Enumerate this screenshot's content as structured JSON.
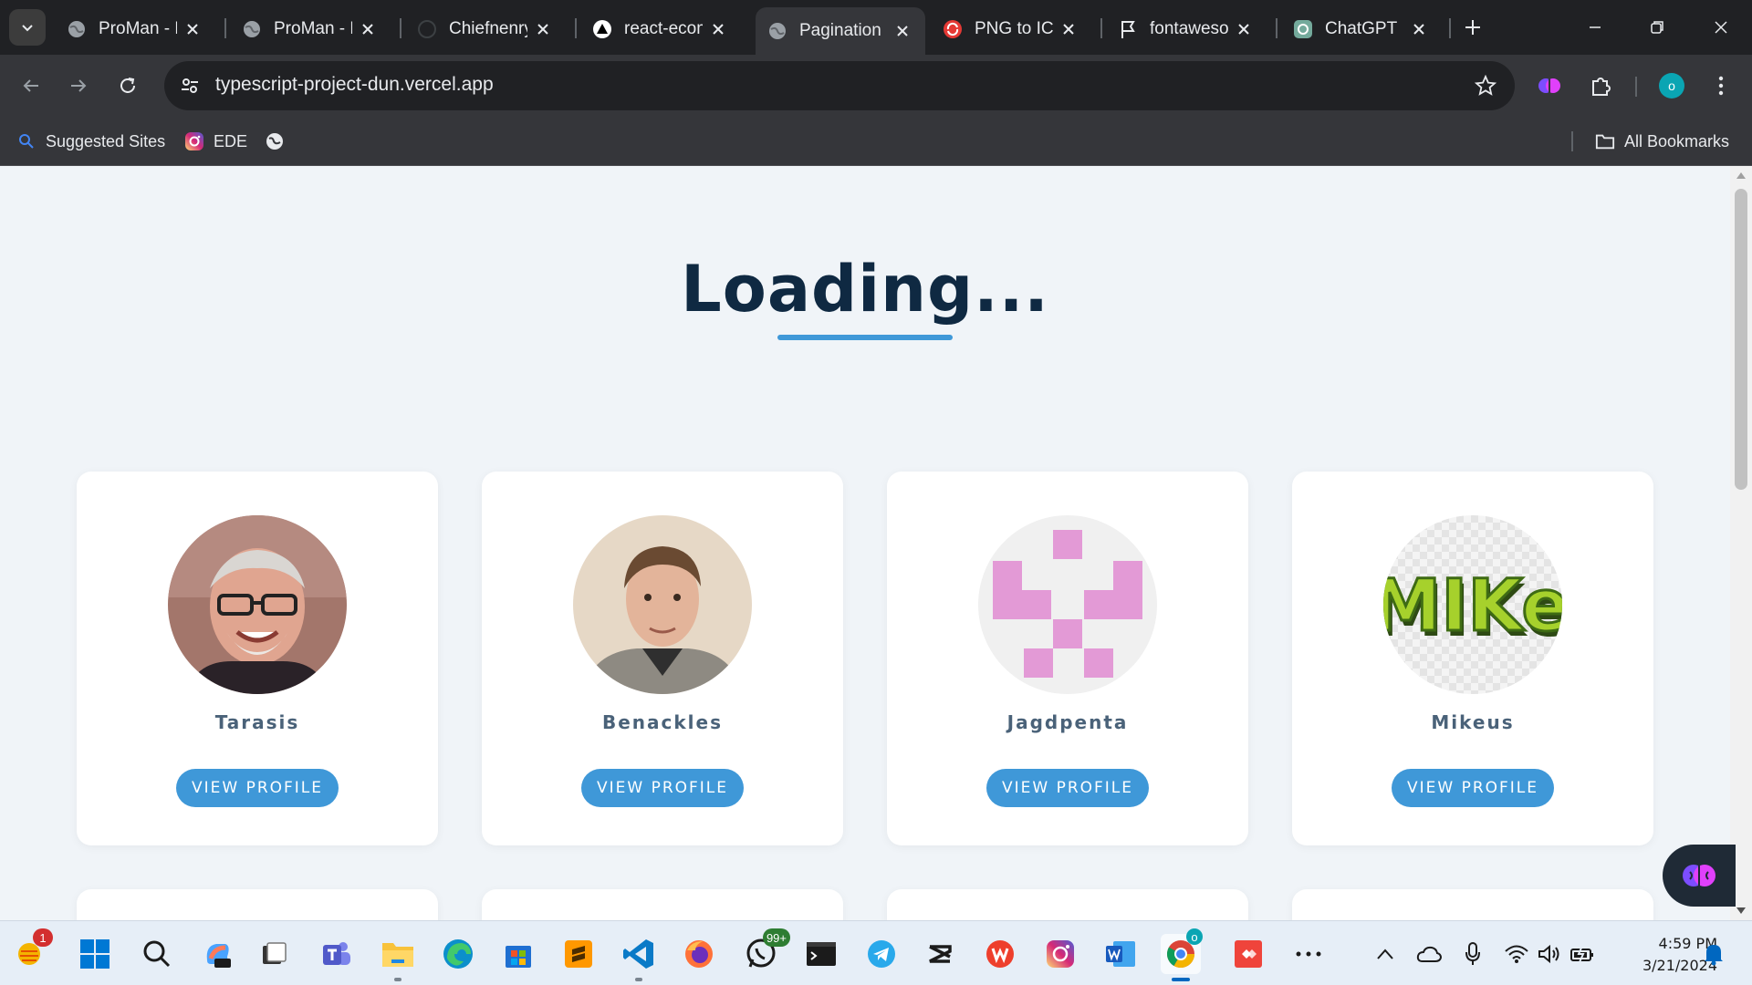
{
  "browser": {
    "tabs": [
      {
        "title": "ProMan - F",
        "icon": "globe-icon"
      },
      {
        "title": "ProMan - F",
        "icon": "globe-icon"
      },
      {
        "title": "Chiefnenry",
        "icon": "github-icon"
      },
      {
        "title": "react-ecom",
        "icon": "vercel-icon"
      },
      {
        "title": "Pagination",
        "icon": "globe-icon",
        "active": true
      },
      {
        "title": "PNG to ICO",
        "icon": "convert-icon"
      },
      {
        "title": "fontaweso",
        "icon": "flag-icon"
      },
      {
        "title": "ChatGPT",
        "icon": "chatgpt-icon"
      }
    ],
    "url": "typescript-project-dun.vercel.app",
    "profile_initial": "o",
    "bookmarks": [
      {
        "label": "Suggested Sites",
        "icon": "search-icon"
      },
      {
        "label": "EDE",
        "icon": "instagram-icon"
      },
      {
        "label": "",
        "icon": "globe-icon"
      }
    ],
    "all_bookmarks_label": "All Bookmarks"
  },
  "page": {
    "heading": "Loading...",
    "button_label": "VIEW PROFILE",
    "users": [
      {
        "name": "Tarasis",
        "avatar": "photo-older-man-glasses"
      },
      {
        "name": "Benackles",
        "avatar": "photo-young-man"
      },
      {
        "name": "Jagdpenta",
        "avatar": "pink-identicon"
      },
      {
        "name": "Mikeus",
        "avatar": "mike-logo"
      }
    ],
    "mike_logo_text": "MIKe"
  },
  "taskbar": {
    "apps": [
      "weather",
      "start",
      "search",
      "copilot",
      "task-view",
      "teams",
      "file-explorer",
      "edge",
      "store",
      "sublime",
      "vscode",
      "firefox",
      "whatsapp",
      "terminal",
      "telegram",
      "capcut",
      "wps",
      "instagram",
      "word",
      "chrome",
      "anydesk",
      "more"
    ],
    "whatsapp_badge": "99+",
    "weather_badge": "1",
    "chrome_badge": "o",
    "time": "4:59 PM",
    "date": "3/21/2024"
  },
  "colors": {
    "accent": "#3f98d8",
    "heading": "#0f2942",
    "page_bg": "#f0f4f8"
  }
}
